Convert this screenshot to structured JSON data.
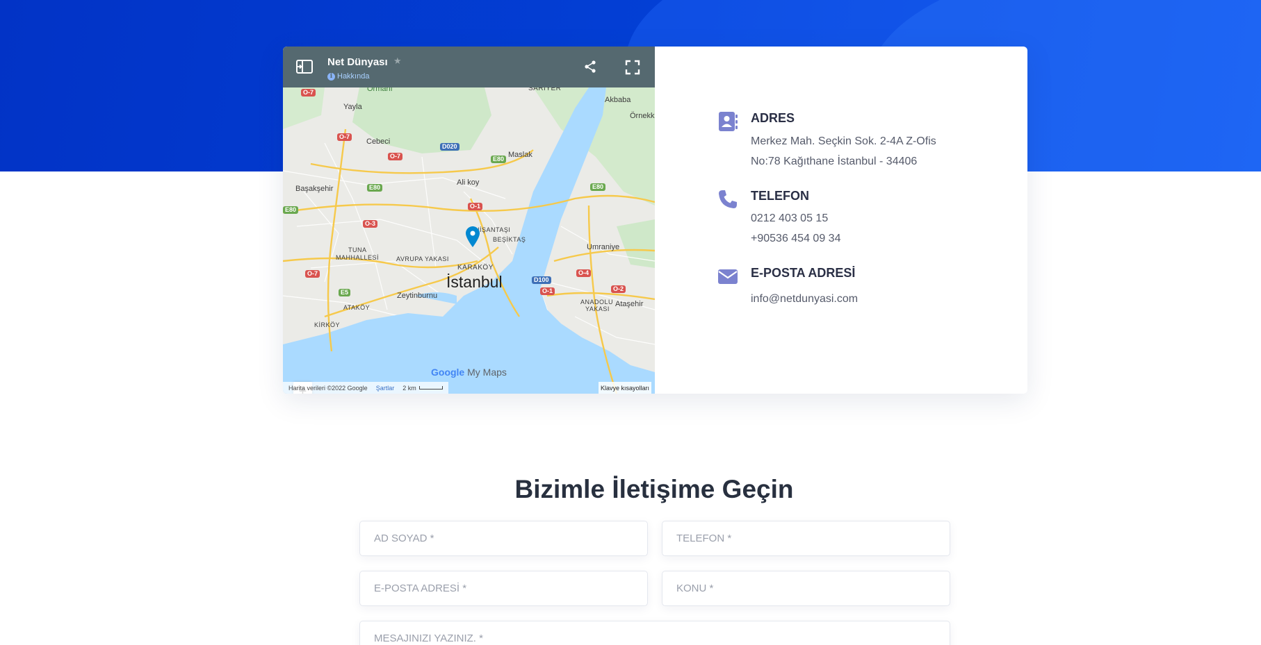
{
  "map": {
    "title": "Net Dünyası",
    "star": "★",
    "about_label": "Hakkında",
    "brand_google": "Google",
    "brand_product": "My Maps",
    "footer_data": "Harita verileri ©2022 Google",
    "footer_terms": "Şartlar",
    "footer_scale": "2 km",
    "footer_shortcuts": "Klavye kısayolları",
    "zoom_in": "+",
    "zoom_out": "−",
    "labels": {
      "sariyer": "SARIYER",
      "ormani": "Ormanı",
      "akbaba": "Akbaba",
      "yayla": "Yayla",
      "ornekkoy": "Örnekk",
      "cebeci": "Cebeci",
      "maslak": "Maslak",
      "basaksehir": "Başakşehir",
      "alibeykoy": "Ali   koy",
      "nisantasi": "NİŞANTAŞI",
      "besiktas": "BEŞİKTAŞ",
      "tuna1": "TUNA",
      "tuna2": "MAHHALLESİ",
      "avrupa": "AVRUPA YAKASI",
      "umraniye": "Umraniye",
      "karakoy": "KARAKÖY",
      "istanbul": "İstanbul",
      "zeytinburnu": "Zeytinburnu",
      "anadolu1": "ANADOLU",
      "anadolu2": "YAKASI",
      "atasehir": "Ataşehir",
      "atakoy": "ATAKÖY",
      "kirkoy": "KİRKÖY"
    },
    "shields": {
      "o7a": "O-7",
      "o7b": "O-7",
      "o7c": "O-7",
      "o7d": "O-7",
      "d020": "D020",
      "e80a": "E80",
      "e80b": "E80",
      "e80c": "E80",
      "e80d": "E80",
      "o1a": "O-1",
      "o1b": "O-1",
      "o3": "O-3",
      "o4": "O-4",
      "o2": "O-2",
      "d100": "D100",
      "e5": "E5"
    }
  },
  "info": {
    "address": {
      "title": "ADRES",
      "line1": "Merkez Mah. Seçkin Sok. 2-4A Z-Ofis",
      "line2": "No:78 Kağıthane İstanbul - 34406"
    },
    "phone": {
      "title": "TELEFON",
      "line1": "0212 403 05 15",
      "line2": "+90536 454 09 34"
    },
    "email": {
      "title": "E-POSTA ADRESİ",
      "line1": "info@netdunyasi.com"
    },
    "icon_color": "#7b82cf"
  },
  "form": {
    "title": "Bizimle İletişime Geçin",
    "name_placeholder": "AD SOYAD *",
    "phone_placeholder": "TELEFON *",
    "email_placeholder": "E-POSTA ADRESİ *",
    "subject_placeholder": "KONU *",
    "message_placeholder": "MESAJINIZI YAZINIZ. *"
  }
}
